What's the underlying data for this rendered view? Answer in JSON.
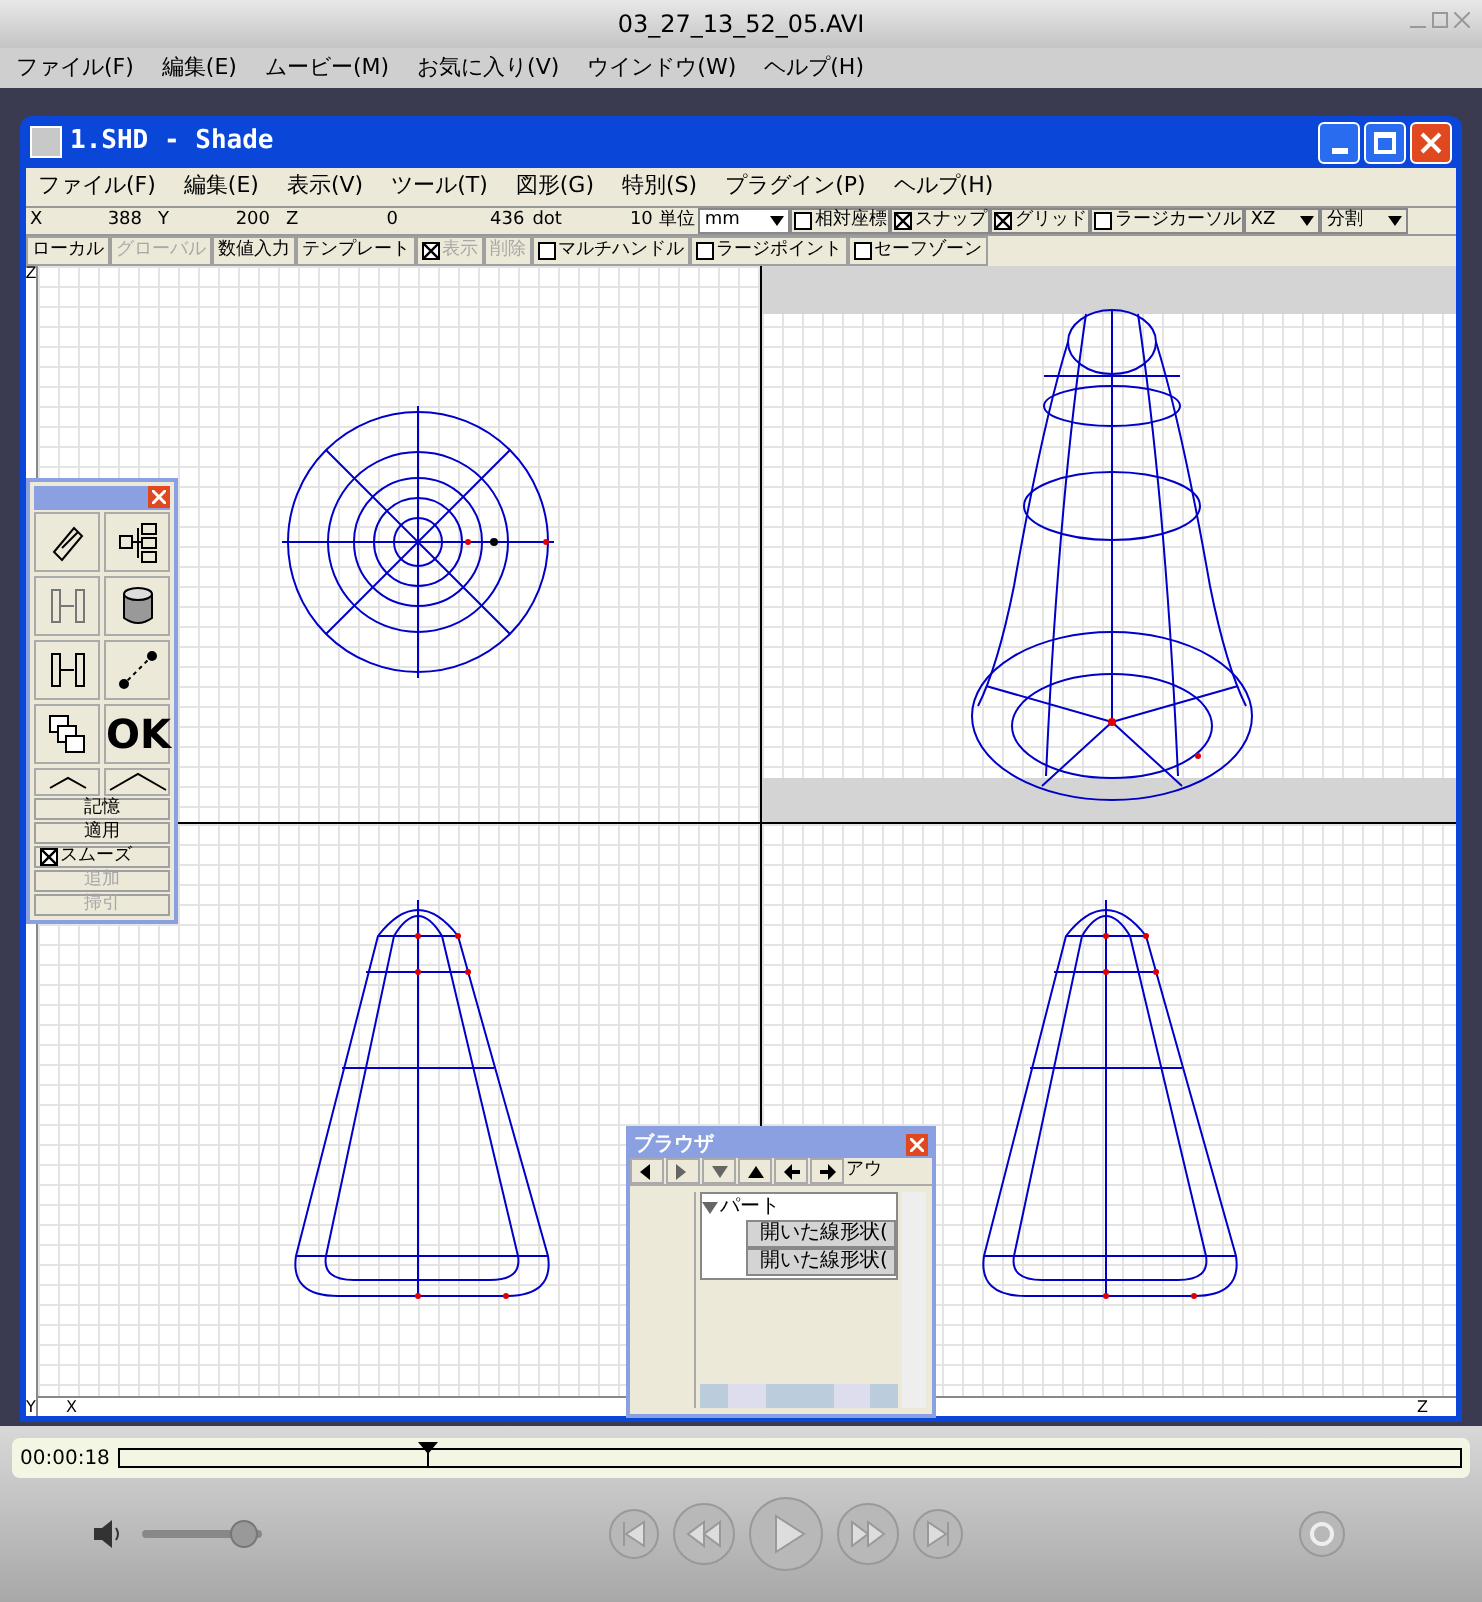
{
  "player": {
    "title": "03_27_13_52_05.AVI",
    "menu": [
      "ファイル(F)",
      "編集(E)",
      "ムービー(M)",
      "お気に入り(V)",
      "ウインドウ(W)",
      "ヘルプ(H)"
    ],
    "timecode": "00:00:18",
    "position": {
      "level": 0.23
    },
    "volume": {
      "level": 0.85
    }
  },
  "shade": {
    "title": "1.SHD - Shade",
    "menu": [
      "ファイル(F)",
      "編集(E)",
      "表示(V)",
      "ツール(T)",
      "図形(G)",
      "特別(S)",
      "プラグイン(P)",
      "ヘルプ(H)"
    ],
    "coords": [
      {
        "label": "X",
        "value": "388"
      },
      {
        "label": "Y",
        "value": "200"
      },
      {
        "label": "Z",
        "value": "0"
      }
    ],
    "dot_value": "436",
    "dot_unit": "dot",
    "grid_value": "10",
    "unit_label": "単位",
    "unit": "mm",
    "options": [
      {
        "label": "相対座標",
        "checked": false
      },
      {
        "label": "スナップ",
        "checked": true
      },
      {
        "label": "グリッド",
        "checked": true
      },
      {
        "label": "ラージカーソル",
        "checked": false
      }
    ],
    "view_select": "XZ",
    "split_select": "分割",
    "toolbar": [
      {
        "kind": "button",
        "label": "ローカル",
        "disabled": false
      },
      {
        "kind": "button",
        "label": "グローバル",
        "disabled": true
      },
      {
        "kind": "button",
        "label": "数値入力",
        "disabled": false
      },
      {
        "kind": "button",
        "label": "テンプレート",
        "disabled": false
      },
      {
        "kind": "check",
        "label": "表示",
        "checked": true,
        "disabled": true
      },
      {
        "kind": "button",
        "label": "削除",
        "disabled": true
      },
      {
        "kind": "check",
        "label": "マルチハンドル",
        "checked": false,
        "disabled": false
      },
      {
        "kind": "check",
        "label": "ラージポイント",
        "checked": false,
        "disabled": false
      },
      {
        "kind": "check",
        "label": "セーフゾーン",
        "checked": false,
        "disabled": false
      }
    ],
    "axis_labels": {
      "top": "Z",
      "left": "Y",
      "bottom": "X",
      "right": "Z"
    },
    "toolbox": {
      "ok_label": "OK",
      "buttons": [
        {
          "kind": "button",
          "label": "記憶",
          "disabled": false
        },
        {
          "kind": "button",
          "label": "適用",
          "disabled": false
        },
        {
          "kind": "check",
          "label": "スムーズ",
          "checked": true,
          "disabled": false
        },
        {
          "kind": "button",
          "label": "追加",
          "disabled": true
        },
        {
          "kind": "button",
          "label": "掃引",
          "disabled": true
        }
      ]
    },
    "browser": {
      "title": "ブラウザ",
      "tab": "アウ",
      "tree": [
        {
          "label": "パート",
          "expanded": true,
          "children": [
            {
              "label": "開いた線形状("
            },
            {
              "label": "開いた線形状("
            }
          ]
        }
      ]
    }
  }
}
